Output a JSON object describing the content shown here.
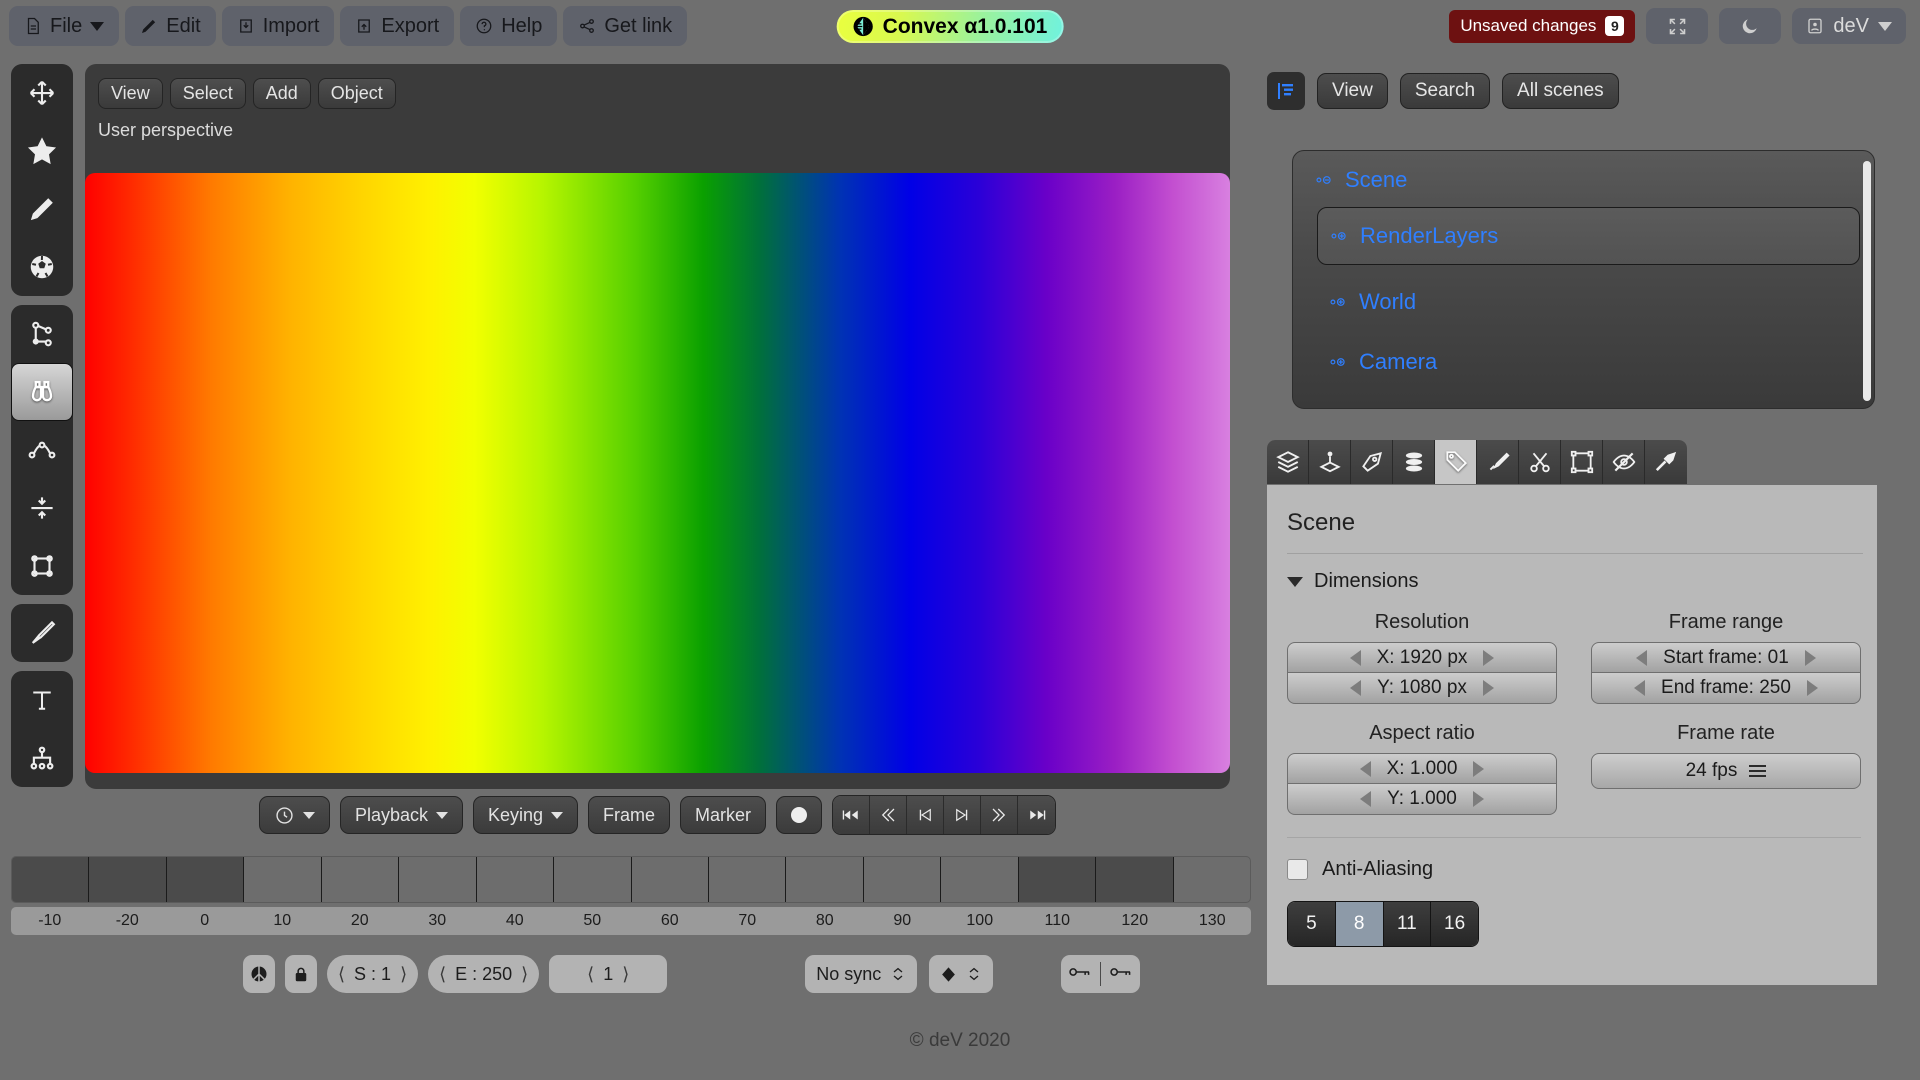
{
  "topbar": {
    "menus": [
      {
        "label": "File",
        "icon": "file-icon",
        "caret": true
      },
      {
        "label": "Edit",
        "icon": "pencil-icon",
        "caret": false
      },
      {
        "label": "Import",
        "icon": "import-icon",
        "caret": false
      },
      {
        "label": "Export",
        "icon": "export-icon",
        "caret": false
      },
      {
        "label": "Help",
        "icon": "help-circle-icon",
        "caret": false
      },
      {
        "label": "Get link",
        "icon": "share-icon",
        "caret": false
      }
    ],
    "brand": {
      "title": "Convex α1.0.101",
      "icon": "convex-logo-icon",
      "gradient_from": "#eaff3e",
      "gradient_to": "#6ff2df"
    },
    "unsaved": {
      "label": "Unsaved changes",
      "count": "9",
      "color": "#6d1111"
    },
    "fullscreen_icon": "expand-icon",
    "theme_icon": "moon-icon",
    "user": {
      "label": "deV",
      "icon": "user-card-icon",
      "caret": true
    }
  },
  "left_toolbar": {
    "groups": [
      {
        "items": [
          {
            "name": "move-tool",
            "icon": "move-arrows-icon",
            "selected": false
          },
          {
            "name": "star-tool",
            "icon": "star-icon",
            "selected": false
          },
          {
            "name": "pencil-tool",
            "icon": "pencil-icon",
            "selected": false
          },
          {
            "name": "ball-tool",
            "icon": "soccer-ball-icon",
            "selected": false
          }
        ]
      },
      {
        "items": [
          {
            "name": "node-tool",
            "icon": "node-graph-icon",
            "selected": false
          },
          {
            "name": "binoculars-tool",
            "icon": "binoculars-icon",
            "selected": true
          },
          {
            "name": "bezier-tool",
            "icon": "bezier-curve-icon",
            "selected": false
          },
          {
            "name": "collapse-tool",
            "icon": "collapse-arrows-icon",
            "selected": false
          },
          {
            "name": "bounds-tool",
            "icon": "bounding-box-icon",
            "selected": false
          }
        ]
      },
      {
        "items": [
          {
            "name": "brush-tool",
            "icon": "paintbrush-icon",
            "selected": false
          }
        ]
      },
      {
        "items": [
          {
            "name": "text-tool",
            "icon": "text-t-icon",
            "selected": false
          },
          {
            "name": "hierarchy-tool",
            "icon": "hierarchy-icon",
            "selected": false
          }
        ]
      }
    ]
  },
  "viewport": {
    "buttons": [
      "View",
      "Select",
      "Add",
      "Object"
    ],
    "status": "User perspective",
    "gradient_name": "spectrum-gradient"
  },
  "timeline_controls": {
    "clock": {
      "name": "clock-menu",
      "icon": "clock-icon"
    },
    "playback": "Playback",
    "keying": "Keying",
    "frame": "Frame",
    "marker": "Marker",
    "record": {
      "name": "record-button",
      "icon": "record-dot-icon"
    },
    "transport": [
      {
        "name": "jump-start-button",
        "icon": "skip-back-icon"
      },
      {
        "name": "rewind-button",
        "icon": "double-left-icon"
      },
      {
        "name": "prev-keyframe-button",
        "icon": "step-back-icon"
      },
      {
        "name": "next-keyframe-button",
        "icon": "step-forward-icon"
      },
      {
        "name": "fast-forward-button",
        "icon": "double-right-icon"
      },
      {
        "name": "jump-end-button",
        "icon": "skip-forward-icon"
      }
    ]
  },
  "ruler": {
    "labels": [
      "-10",
      "-20",
      "0",
      "10",
      "20",
      "30",
      "40",
      "50",
      "60",
      "70",
      "80",
      "90",
      "100",
      "110",
      "120",
      "130"
    ],
    "dark_cells": [
      0,
      1,
      2,
      13,
      14
    ]
  },
  "statusbar": {
    "peace_button": {
      "name": "peace-toggle",
      "icon": "peace-icon"
    },
    "lock_button": {
      "name": "lock-toggle",
      "icon": "lock-icon"
    },
    "start": {
      "label": "S : 1"
    },
    "end": {
      "label": "E : 250"
    },
    "current": {
      "label": "1"
    },
    "sync": {
      "label": "No sync",
      "icon": "updown-arrows-icon"
    },
    "keyframe": {
      "name": "keyframe-type",
      "icon": "diamond-icon",
      "icon2": "updown-arrows-icon"
    },
    "keys": [
      {
        "name": "key-left-button",
        "icon": "key-icon"
      },
      {
        "name": "key-right-button",
        "icon": "key-icon"
      }
    ]
  },
  "footer": {
    "copyright": "© deV 2020"
  },
  "outliner": {
    "icon": "outliner-icon",
    "buttons": [
      "View",
      "Search",
      "All scenes"
    ],
    "tree": {
      "root": {
        "label": "Scene",
        "expander": "minus-circle-icon"
      },
      "selected": {
        "label": "RenderLayers",
        "expander": "plus-circle-icon"
      },
      "children": [
        {
          "label": "World",
          "expander": "plus-circle-icon"
        },
        {
          "label": "Camera",
          "expander": "plus-circle-icon"
        }
      ]
    },
    "link_color": "#2f7fff"
  },
  "properties": {
    "tabs": [
      {
        "name": "tab-layers",
        "icon": "layers-icon",
        "selected": false
      },
      {
        "name": "tab-joystick",
        "icon": "joystick-icon",
        "selected": false
      },
      {
        "name": "tab-pen",
        "icon": "pen-nib-icon",
        "selected": false
      },
      {
        "name": "tab-data",
        "icon": "database-icon",
        "selected": false
      },
      {
        "name": "tab-scene",
        "icon": "tag-icon",
        "selected": true
      },
      {
        "name": "tab-needle",
        "icon": "needle-icon",
        "selected": false
      },
      {
        "name": "tab-scissors",
        "icon": "scissors-icon",
        "selected": false
      },
      {
        "name": "tab-transform",
        "icon": "transform-box-icon",
        "selected": false
      },
      {
        "name": "tab-visibility",
        "icon": "eye-off-icon",
        "selected": false
      },
      {
        "name": "tab-tools",
        "icon": "hammer-icon",
        "selected": false
      }
    ],
    "title": "Scene",
    "section": "Dimensions",
    "resolution": {
      "label": "Resolution",
      "x": "X: 1920 px",
      "y": "Y: 1080 px"
    },
    "frame_range": {
      "label": "Frame range",
      "start": "Start frame: 01",
      "end": "End frame: 250"
    },
    "aspect_ratio": {
      "label": "Aspect ratio",
      "x": "X: 1.000",
      "y": "Y: 1.000"
    },
    "frame_rate": {
      "label": "Frame rate",
      "value": "24 fps"
    },
    "anti_aliasing": {
      "label": "Anti-Aliasing",
      "checked": false
    },
    "aa_options": [
      "5",
      "8",
      "11",
      "16"
    ],
    "aa_selected": "8"
  }
}
